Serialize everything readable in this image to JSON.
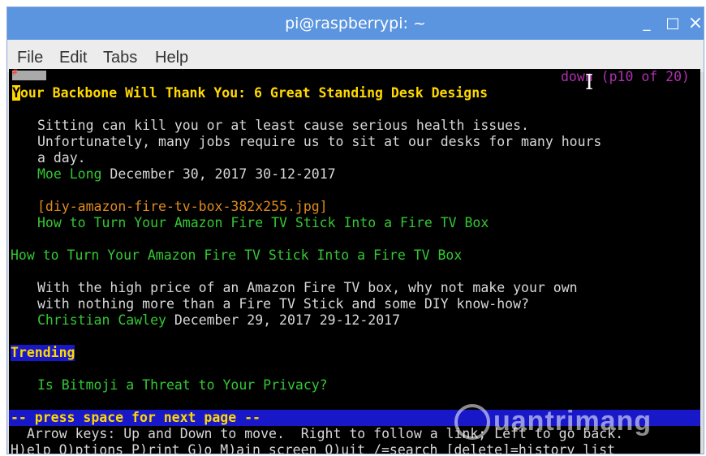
{
  "window": {
    "title": "pi@raspberrypi: ~",
    "minimize": "_",
    "maximize": "□",
    "close": "×"
  },
  "menu": [
    "File",
    "Edit",
    "Tabs",
    "Help"
  ],
  "terminal": {
    "hash_marker": "#",
    "status": "down (p10 of 20)",
    "headline_first": "Y",
    "headline_rest": "our Backbone Will Thank You: 6 Great Standing Desk Designs",
    "para1": [
      "Sitting can kill you or at least cause serious health issues.",
      "Unfortunately, many jobs require us to sit at our desks for many hours",
      "a day."
    ],
    "author1": "Moe Long",
    "date1": " December 30, 2017 30-12-2017",
    "image_link": "[diy-amazon-fire-tv-box-382x255.jpg]",
    "link1": "How to Turn Your Amazon Fire TV Stick Into a Fire TV Box",
    "link2": "How to Turn Your Amazon Fire TV Stick Into a Fire TV Box",
    "para2": [
      "With the high price of an Amazon Fire TV box, why not make your own",
      "with nothing more than a Fire TV Stick and some DIY know-how?"
    ],
    "author2": "Christian Cawley",
    "date2": " December 29, 2017 29-12-2017",
    "trending": "Trending",
    "trending_link": "Is Bitmoji a Threat to Your Privacy?",
    "prompt": "-- press space for next page --",
    "help1": "Arrow keys: Up and Down to move.  Right to follow a link; Left to go back.",
    "help2": "H)elp O)ptions P)rint G)o M)ain screen Q)uit /=search [delete]=history list"
  },
  "watermark": "uantrimang"
}
